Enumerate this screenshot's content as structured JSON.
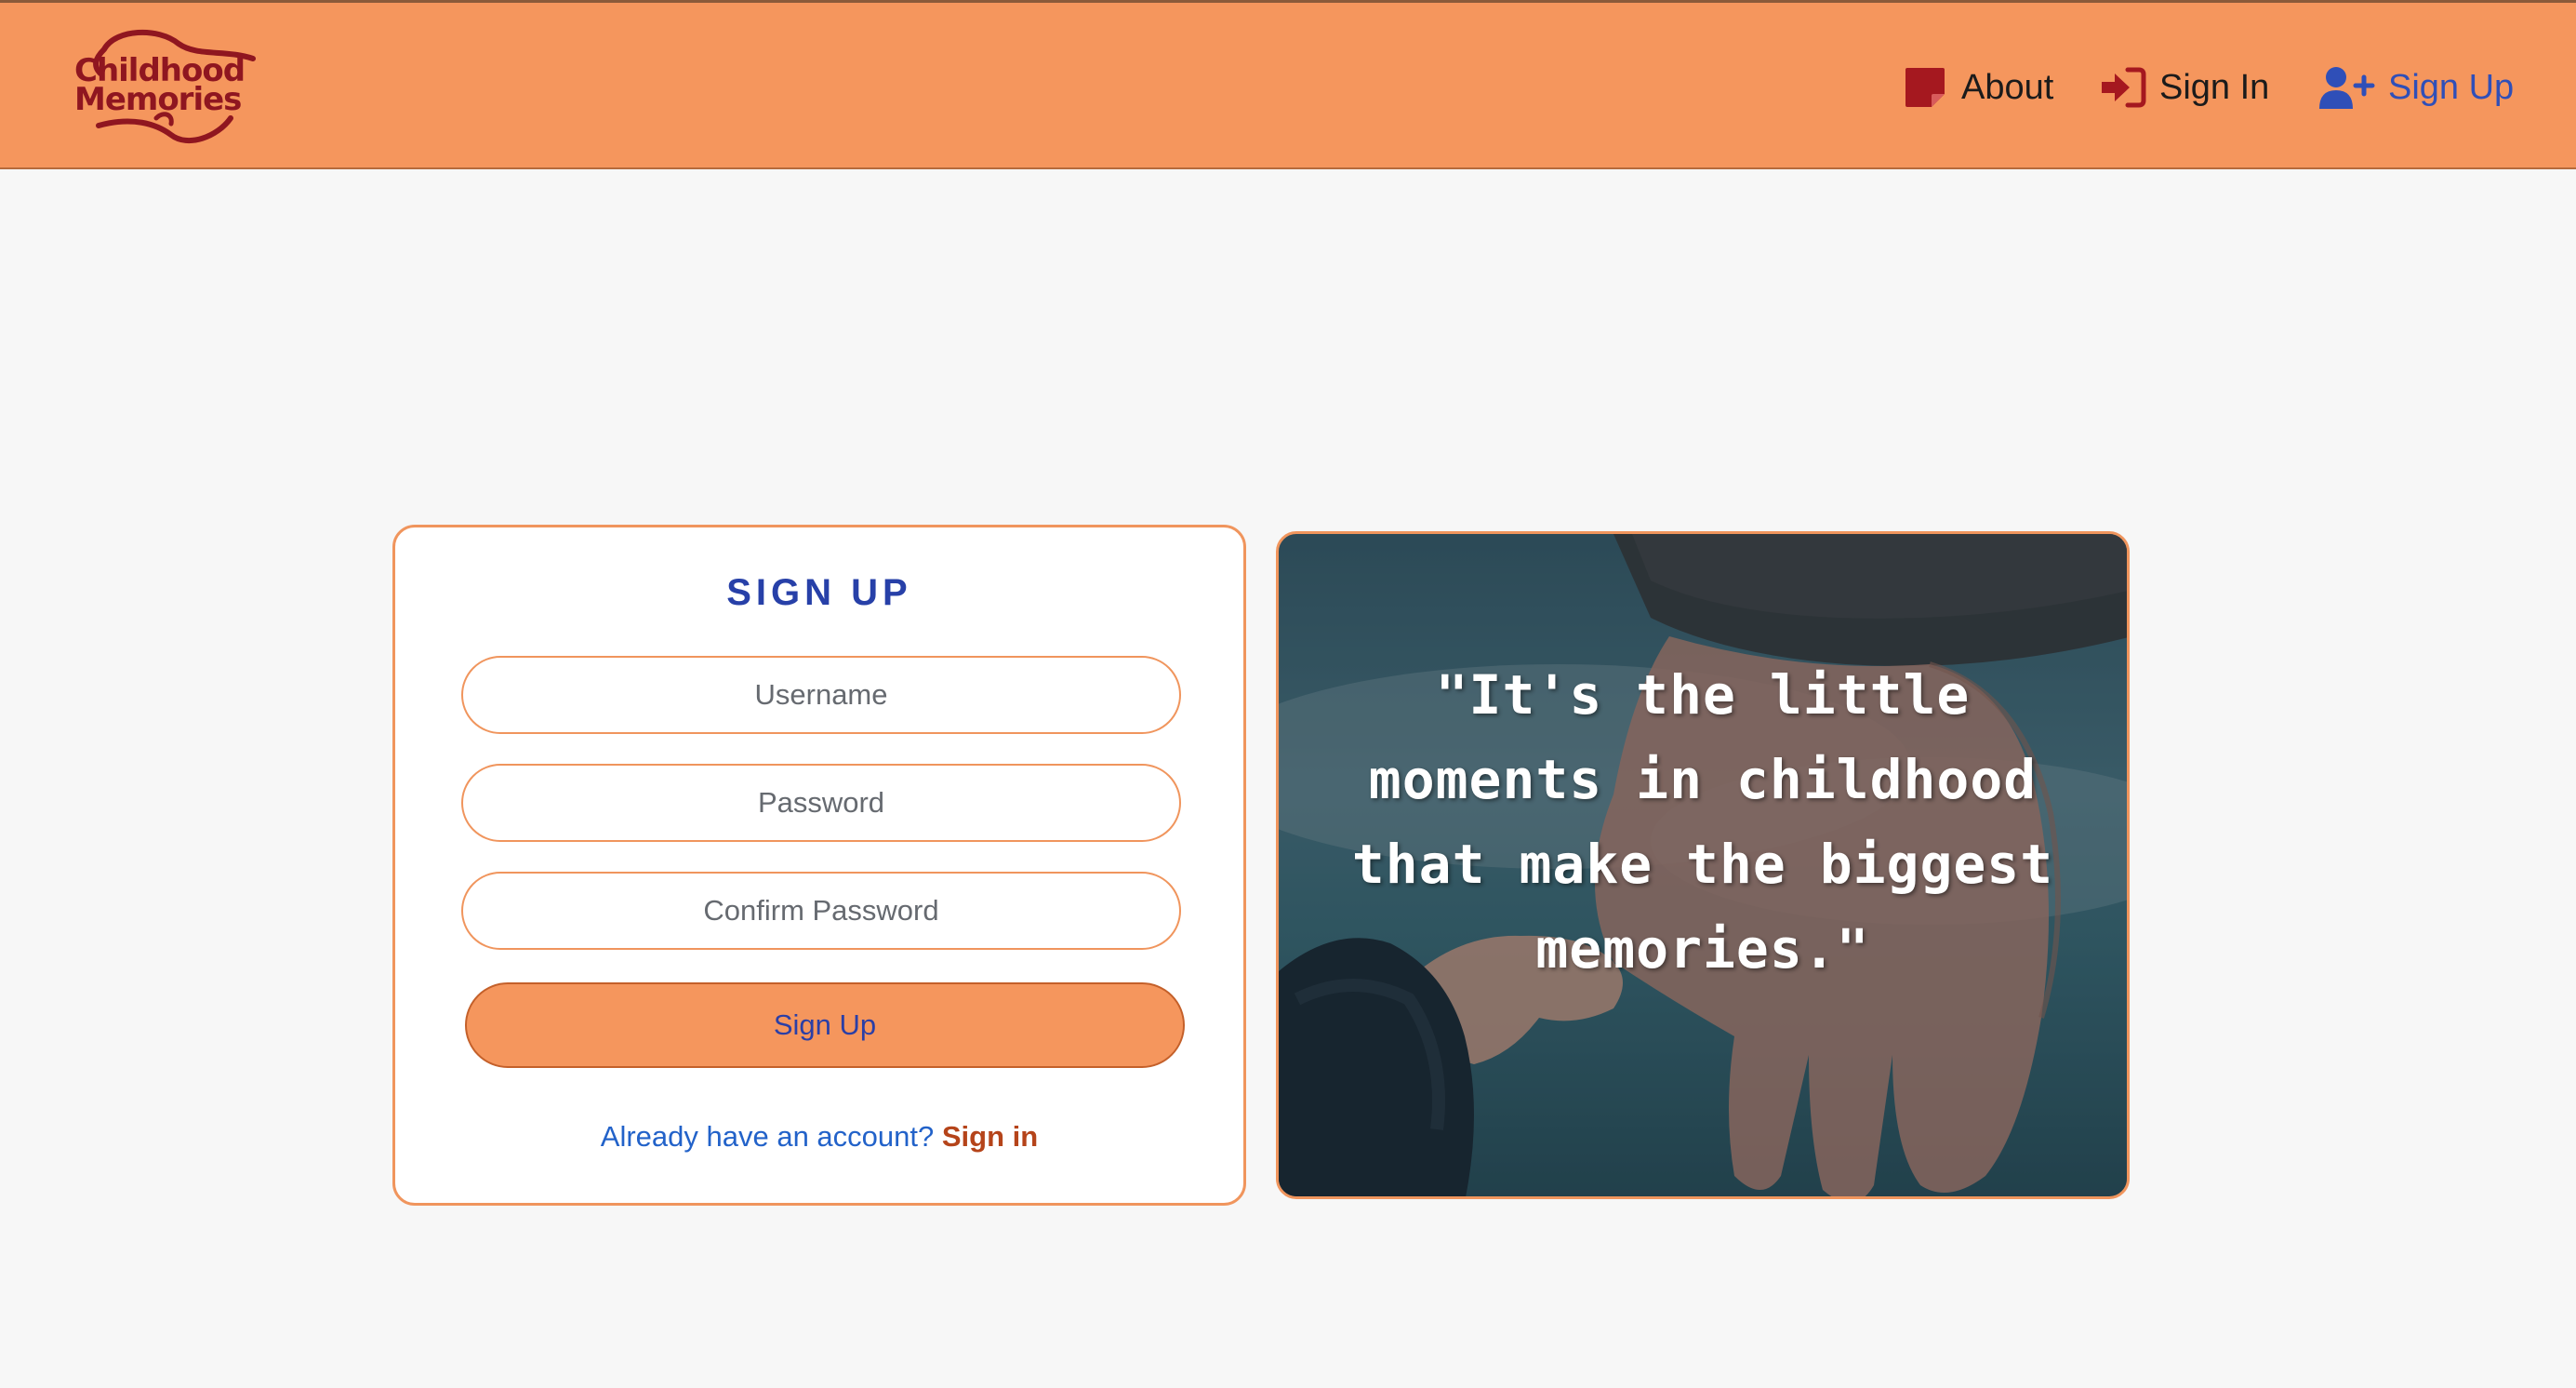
{
  "brand": {
    "logo_text": "Childhood Memories",
    "colors": {
      "header": "#f5965d",
      "logo": "#8f1620",
      "accent_blue": "#2740a8",
      "link_orange": "#b5441a"
    }
  },
  "nav": {
    "about": {
      "label": "About",
      "icon": "sticky-note-icon"
    },
    "signin": {
      "label": "Sign In",
      "icon": "sign-in-icon"
    },
    "signup": {
      "label": "Sign Up",
      "icon": "user-plus-icon"
    }
  },
  "form": {
    "title": "SIGN UP",
    "username_placeholder": "Username",
    "password_placeholder": "Password",
    "confirm_placeholder": "Confirm Password",
    "submit_label": "Sign Up",
    "already_text": "Already have an account?",
    "signin_link": "Sign in"
  },
  "hero": {
    "quote": "\"It's the little moments in childhood that make the biggest memories.\""
  }
}
